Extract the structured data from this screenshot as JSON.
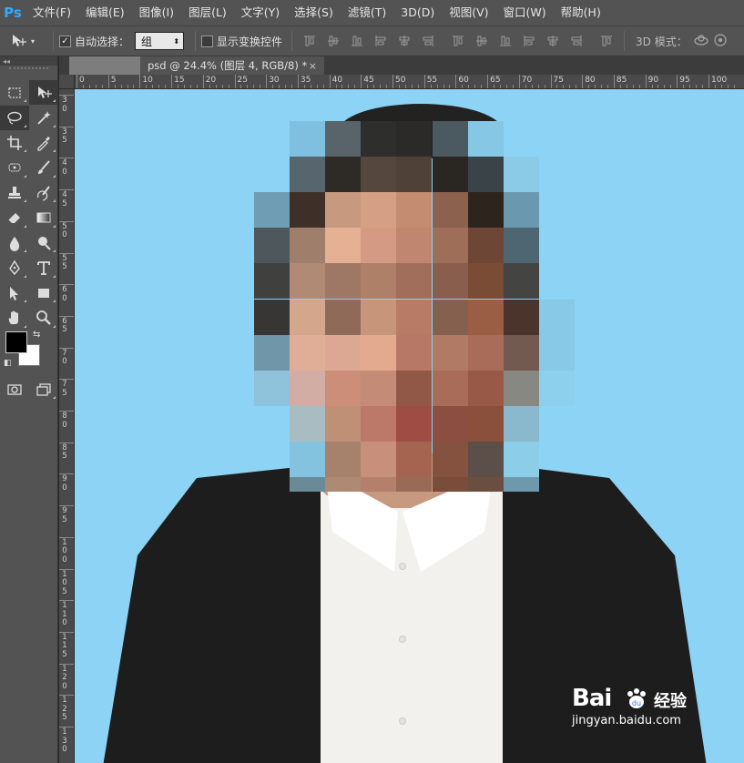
{
  "app": {
    "logo": "Ps"
  },
  "menu": [
    "文件(F)",
    "编辑(E)",
    "图像(I)",
    "图层(L)",
    "文字(Y)",
    "选择(S)",
    "滤镜(T)",
    "3D(D)",
    "视图(V)",
    "窗口(W)",
    "帮助(H)"
  ],
  "options": {
    "auto_select_label": "自动选择：",
    "auto_select_checked": true,
    "auto_select_value": "组",
    "show_transform_label": "显示变换控件",
    "show_transform_checked": false,
    "mode_3d_label": "3D 模式："
  },
  "document": {
    "tab_title": "psd @ 24.4% (图层 4, RGB/8) *",
    "close_glyph": "×"
  },
  "rulers": {
    "top": [
      "0",
      "5",
      "10",
      "15",
      "20",
      "25",
      "30",
      "35",
      "40",
      "45",
      "50",
      "55",
      "60",
      "65",
      "70",
      "75",
      "80",
      "85",
      "90",
      "95",
      "100"
    ],
    "left": [
      "3 0",
      "3 5",
      "4 0",
      "4 5",
      "5 0",
      "5 5",
      "6 0",
      "6 5",
      "7 0",
      "7 5",
      "8 0",
      "8 5",
      "9 0",
      "9 5",
      "1 0 0",
      "1 0 5",
      "1 1 0",
      "1 1 5",
      "1 2 0",
      "1 2 5",
      "1 3 0"
    ]
  },
  "colors": {
    "foreground": "#000000",
    "background": "#ffffff",
    "canvas_bg": "#8cd3f5",
    "app_accent": "#31a8ff"
  },
  "tools": [
    [
      "marquee-tool-icon",
      "move-tool-icon"
    ],
    [
      "lasso-tool-icon",
      "magic-wand-tool-icon"
    ],
    [
      "crop-tool-icon",
      "eyedropper-tool-icon"
    ],
    [
      "healing-brush-tool-icon",
      "brush-tool-icon"
    ],
    [
      "clone-stamp-tool-icon",
      "history-brush-tool-icon"
    ],
    [
      "eraser-tool-icon",
      "gradient-tool-icon"
    ],
    [
      "blur-tool-icon",
      "dodge-tool-icon"
    ],
    [
      "pen-tool-icon",
      "type-tool-icon"
    ],
    [
      "path-selection-tool-icon",
      "rectangle-tool-icon"
    ],
    [
      "hand-tool-icon",
      "zoom-tool-icon"
    ]
  ],
  "watermark": {
    "logo_a": "Bai",
    "logo_b": "du",
    "cn": "经验",
    "url": "jingyan.baidu.com"
  }
}
